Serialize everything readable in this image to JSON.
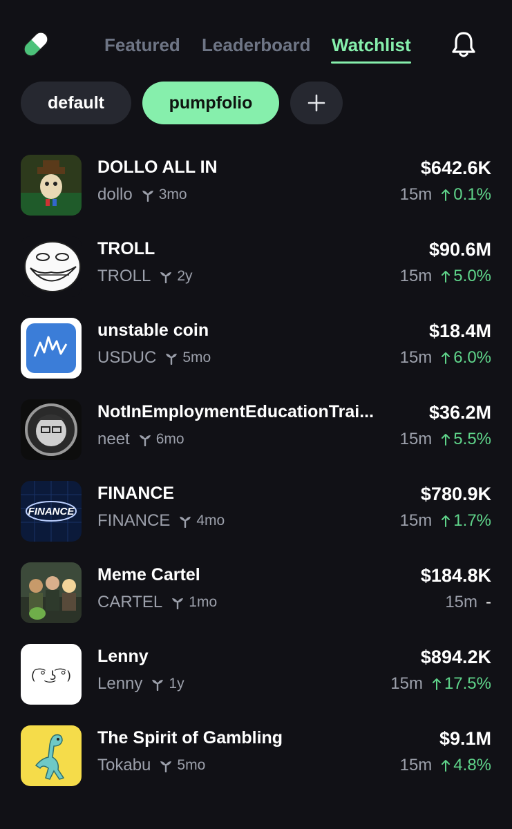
{
  "nav": {
    "tabs": [
      {
        "label": "Featured"
      },
      {
        "label": "Leaderboard"
      },
      {
        "label": "Watchlist"
      }
    ],
    "active_tab": "Watchlist"
  },
  "lists": {
    "chips": [
      {
        "label": "default"
      },
      {
        "label": "pumpfolio"
      },
      {
        "label": "+"
      }
    ],
    "active_chip": "pumpfolio"
  },
  "colors": {
    "background": "#111116",
    "accent": "#86efac",
    "positive": "#5fd48a",
    "muted": "#9ca0ab"
  },
  "tokens": [
    {
      "name": "DOLLO ALL IN",
      "ticker": "dollo",
      "age": "3mo",
      "market_cap": "$642.6K",
      "period": "15m",
      "change": "0.1%",
      "direction": "up",
      "icon": "cat-poker-avatar"
    },
    {
      "name": "TROLL",
      "ticker": "TROLL",
      "age": "2y",
      "market_cap": "$90.6M",
      "period": "15m",
      "change": "5.0%",
      "direction": "up",
      "icon": "trollface-avatar"
    },
    {
      "name": "unstable coin",
      "ticker": "USDUC",
      "age": "5mo",
      "market_cap": "$18.4M",
      "period": "15m",
      "change": "6.0%",
      "direction": "up",
      "icon": "zigzag-chart-avatar"
    },
    {
      "name": "NotInEmploymentEducationTrai...",
      "ticker": "neet",
      "age": "6mo",
      "market_cap": "$36.2M",
      "period": "15m",
      "change": "5.5%",
      "direction": "up",
      "icon": "neet-face-avatar"
    },
    {
      "name": "FINANCE",
      "ticker": "FINANCE",
      "age": "4mo",
      "market_cap": "$780.9K",
      "period": "15m",
      "change": "1.7%",
      "direction": "up",
      "icon": "finance-logo-avatar"
    },
    {
      "name": "Meme Cartel",
      "ticker": "CARTEL",
      "age": "1mo",
      "market_cap": "$184.8K",
      "period": "15m",
      "change": "-",
      "direction": "flat",
      "icon": "cartel-group-avatar"
    },
    {
      "name": "Lenny",
      "ticker": "Lenny",
      "age": "1y",
      "market_cap": "$894.2K",
      "period": "15m",
      "change": "17.5%",
      "direction": "up",
      "icon": "lenny-face-avatar"
    },
    {
      "name": "The Spirit of Gambling",
      "ticker": "Tokabu",
      "age": "5mo",
      "market_cap": "$9.1M",
      "period": "15m",
      "change": "4.8%",
      "direction": "up",
      "icon": "tokabu-lizard-avatar"
    }
  ]
}
